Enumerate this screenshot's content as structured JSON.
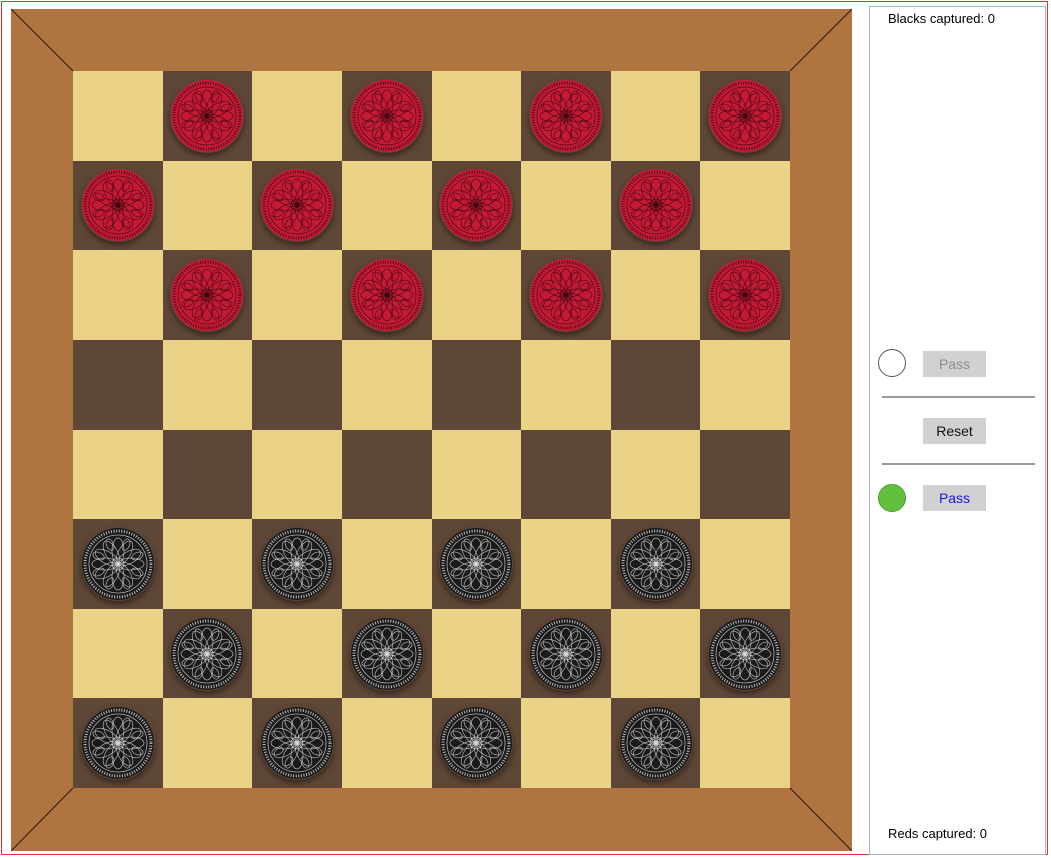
{
  "board": {
    "size": 8,
    "light_color": "#ead287",
    "dark_color": "#5f4737",
    "frame_color": "#b07440",
    "pieces": [
      {
        "color": "red",
        "row": 0,
        "col": 1
      },
      {
        "color": "red",
        "row": 0,
        "col": 3
      },
      {
        "color": "red",
        "row": 0,
        "col": 5
      },
      {
        "color": "red",
        "row": 0,
        "col": 7
      },
      {
        "color": "red",
        "row": 1,
        "col": 0
      },
      {
        "color": "red",
        "row": 1,
        "col": 2
      },
      {
        "color": "red",
        "row": 1,
        "col": 4
      },
      {
        "color": "red",
        "row": 1,
        "col": 6
      },
      {
        "color": "red",
        "row": 2,
        "col": 1
      },
      {
        "color": "red",
        "row": 2,
        "col": 3
      },
      {
        "color": "red",
        "row": 2,
        "col": 5
      },
      {
        "color": "red",
        "row": 2,
        "col": 7
      },
      {
        "color": "black",
        "row": 5,
        "col": 0
      },
      {
        "color": "black",
        "row": 5,
        "col": 2
      },
      {
        "color": "black",
        "row": 5,
        "col": 4
      },
      {
        "color": "black",
        "row": 5,
        "col": 6
      },
      {
        "color": "black",
        "row": 6,
        "col": 1
      },
      {
        "color": "black",
        "row": 6,
        "col": 3
      },
      {
        "color": "black",
        "row": 6,
        "col": 5
      },
      {
        "color": "black",
        "row": 6,
        "col": 7
      },
      {
        "color": "black",
        "row": 7,
        "col": 0
      },
      {
        "color": "black",
        "row": 7,
        "col": 2
      },
      {
        "color": "black",
        "row": 7,
        "col": 4
      },
      {
        "color": "black",
        "row": 7,
        "col": 6
      }
    ],
    "piece_colors": {
      "red": "#c51a35",
      "black": "#1a1a1a"
    }
  },
  "panel": {
    "blacks_captured": "Blacks captured: 0",
    "reds_captured": "Reds captured: 0",
    "top_player": {
      "pass_label": "Pass",
      "active": false
    },
    "reset_label": "Reset",
    "bottom_player": {
      "pass_label": "Pass",
      "active": true
    },
    "active_color": "#63c03f"
  }
}
